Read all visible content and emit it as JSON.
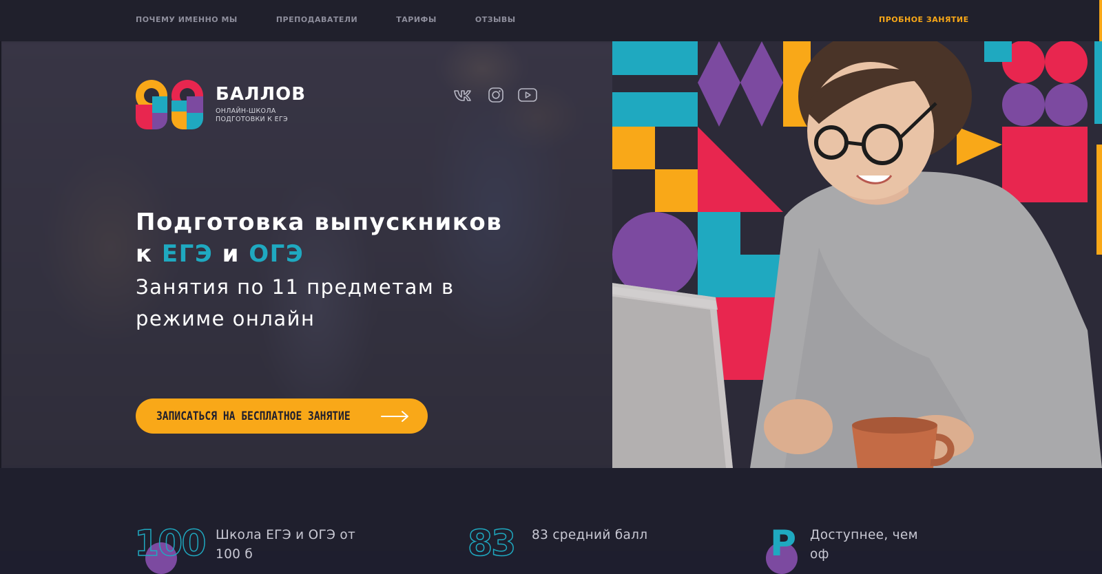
{
  "nav": {
    "links": [
      "ПОЧЕМУ ИМЕННО МЫ",
      "ПРЕПОДАВАТЕЛИ",
      "ТАРИФЫ",
      "ОТЗЫВЫ"
    ],
    "cta": "ПРОБНОЕ ЗАНЯТИЕ"
  },
  "logo": {
    "title": "БАЛЛОВ",
    "subtitle_line1": "ОНЛАЙН-ШКОЛА",
    "subtitle_line2": "ПОДГОТОВКИ К ЕГЭ"
  },
  "social": {
    "icons": [
      "vk-icon",
      "instagram-icon",
      "youtube-icon"
    ]
  },
  "hero": {
    "title_line1": "Подготовка выпускников",
    "title_prefix": "к ",
    "title_accent1": "ЕГЭ",
    "title_mid": " и ",
    "title_accent2": "ОГЭ",
    "subtitle_line1": "Занятия по 11 предметам в",
    "subtitle_line2": "режиме онлайн",
    "cta_label": "ЗАПИСАТЬСЯ НА БЕСПЛАТНОЕ ЗАНЯТИЕ"
  },
  "stats": [
    {
      "number": "100",
      "line1": "Школа ЕГЭ и ОГЭ от",
      "line2": "100 б"
    },
    {
      "number": "83",
      "line1": "83 средний балл",
      "line2": ""
    },
    {
      "number": "Р",
      "line1": "Доступнее, чем",
      "line2": "оф"
    }
  ],
  "colors": {
    "accent_orange": "#f9a818",
    "accent_teal": "#1fa9c0",
    "accent_pink": "#e8264f",
    "accent_purple": "#7c4aa0",
    "background": "#20202c"
  }
}
